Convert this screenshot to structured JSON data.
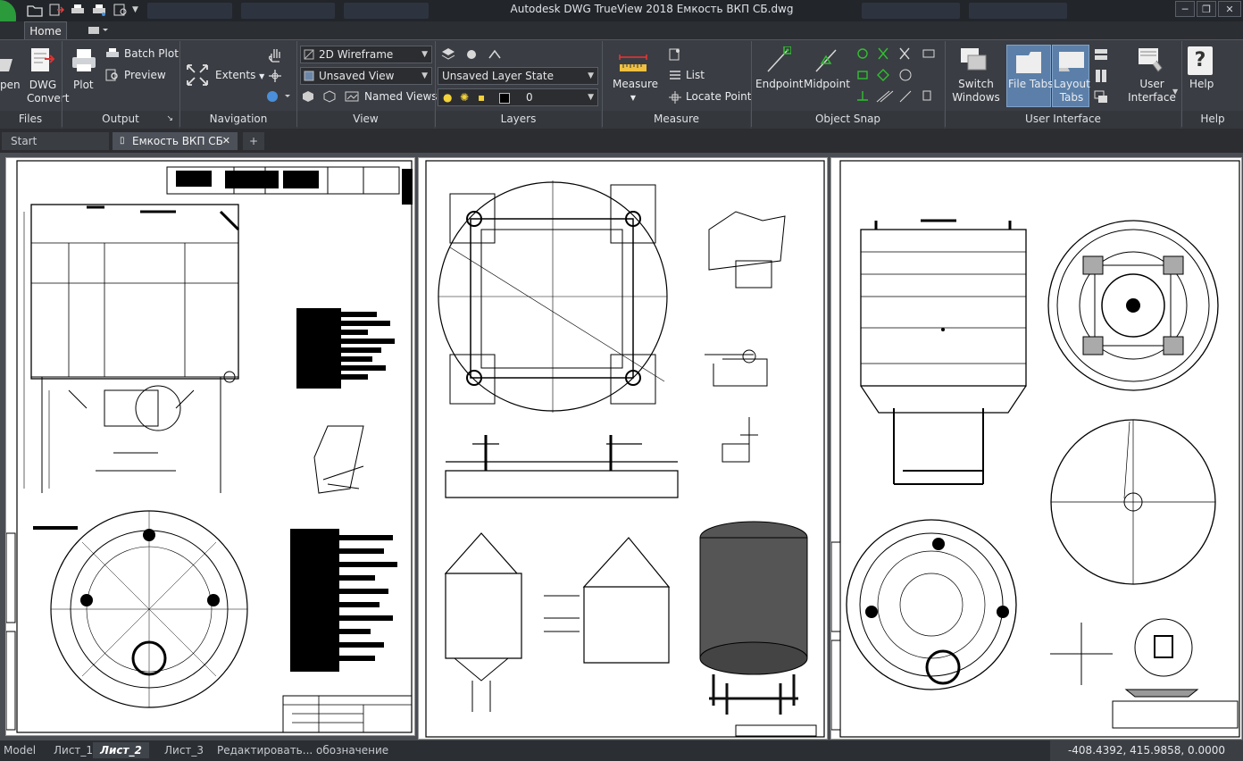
{
  "title_bar": {
    "title": "Autodesk DWG TrueView 2018    Емкость ВКП СБ.dwg"
  },
  "ribbon_tabs": {
    "home": "Home"
  },
  "files": {
    "open_label": "pen",
    "dwg_convert_line1": "DWG",
    "dwg_convert_line2": "Convert",
    "panel_title": "Files"
  },
  "output": {
    "plot_label": "Plot",
    "batch_plot_label": "Batch Plot",
    "preview_label": "Preview",
    "panel_title": "Output"
  },
  "navigation": {
    "extents_label": "Extents",
    "panel_title": "Navigation"
  },
  "view": {
    "visual_style": "2D Wireframe",
    "saved_view": "Unsaved View",
    "named_views_label": "Named Views",
    "panel_title": "View"
  },
  "layers": {
    "layer_state": "Unsaved Layer State",
    "current_layer": "0",
    "panel_title": "Layers"
  },
  "measure": {
    "measure_label": "Measure",
    "list_label": "List",
    "locate_point_label": "Locate Point",
    "panel_title": "Measure"
  },
  "object_snap": {
    "endpoint_label": "Endpoint",
    "midpoint_label": "Midpoint",
    "panel_title": "Object Snap"
  },
  "user_interface": {
    "switch_windows_line1": "Switch",
    "switch_windows_line2": "Windows",
    "file_tabs_label": "File Tabs",
    "layout_tabs_line1": "Layout",
    "layout_tabs_line2": "Tabs",
    "user_interface_line1": "User",
    "user_interface_line2": "Interface",
    "panel_title": "User Interface"
  },
  "help": {
    "help_label": "Help",
    "panel_title": "Help"
  },
  "doc_tabs": {
    "start": "Start",
    "active": "Емкость ВКП СБ",
    "add": "+"
  },
  "layout_tabs": {
    "model": "Model",
    "list1": "Лист_1",
    "list2": "Лист_2",
    "list3": "Лист_3",
    "edit": "Редактировать... обозначение"
  },
  "status": {
    "coordinates": "-408.4392, 415.9858, 0.0000"
  },
  "colors": {
    "ribbon_bg": "#3a3d43",
    "highlight": "#5b7fa8",
    "logo_green": "#2a9a3a"
  }
}
